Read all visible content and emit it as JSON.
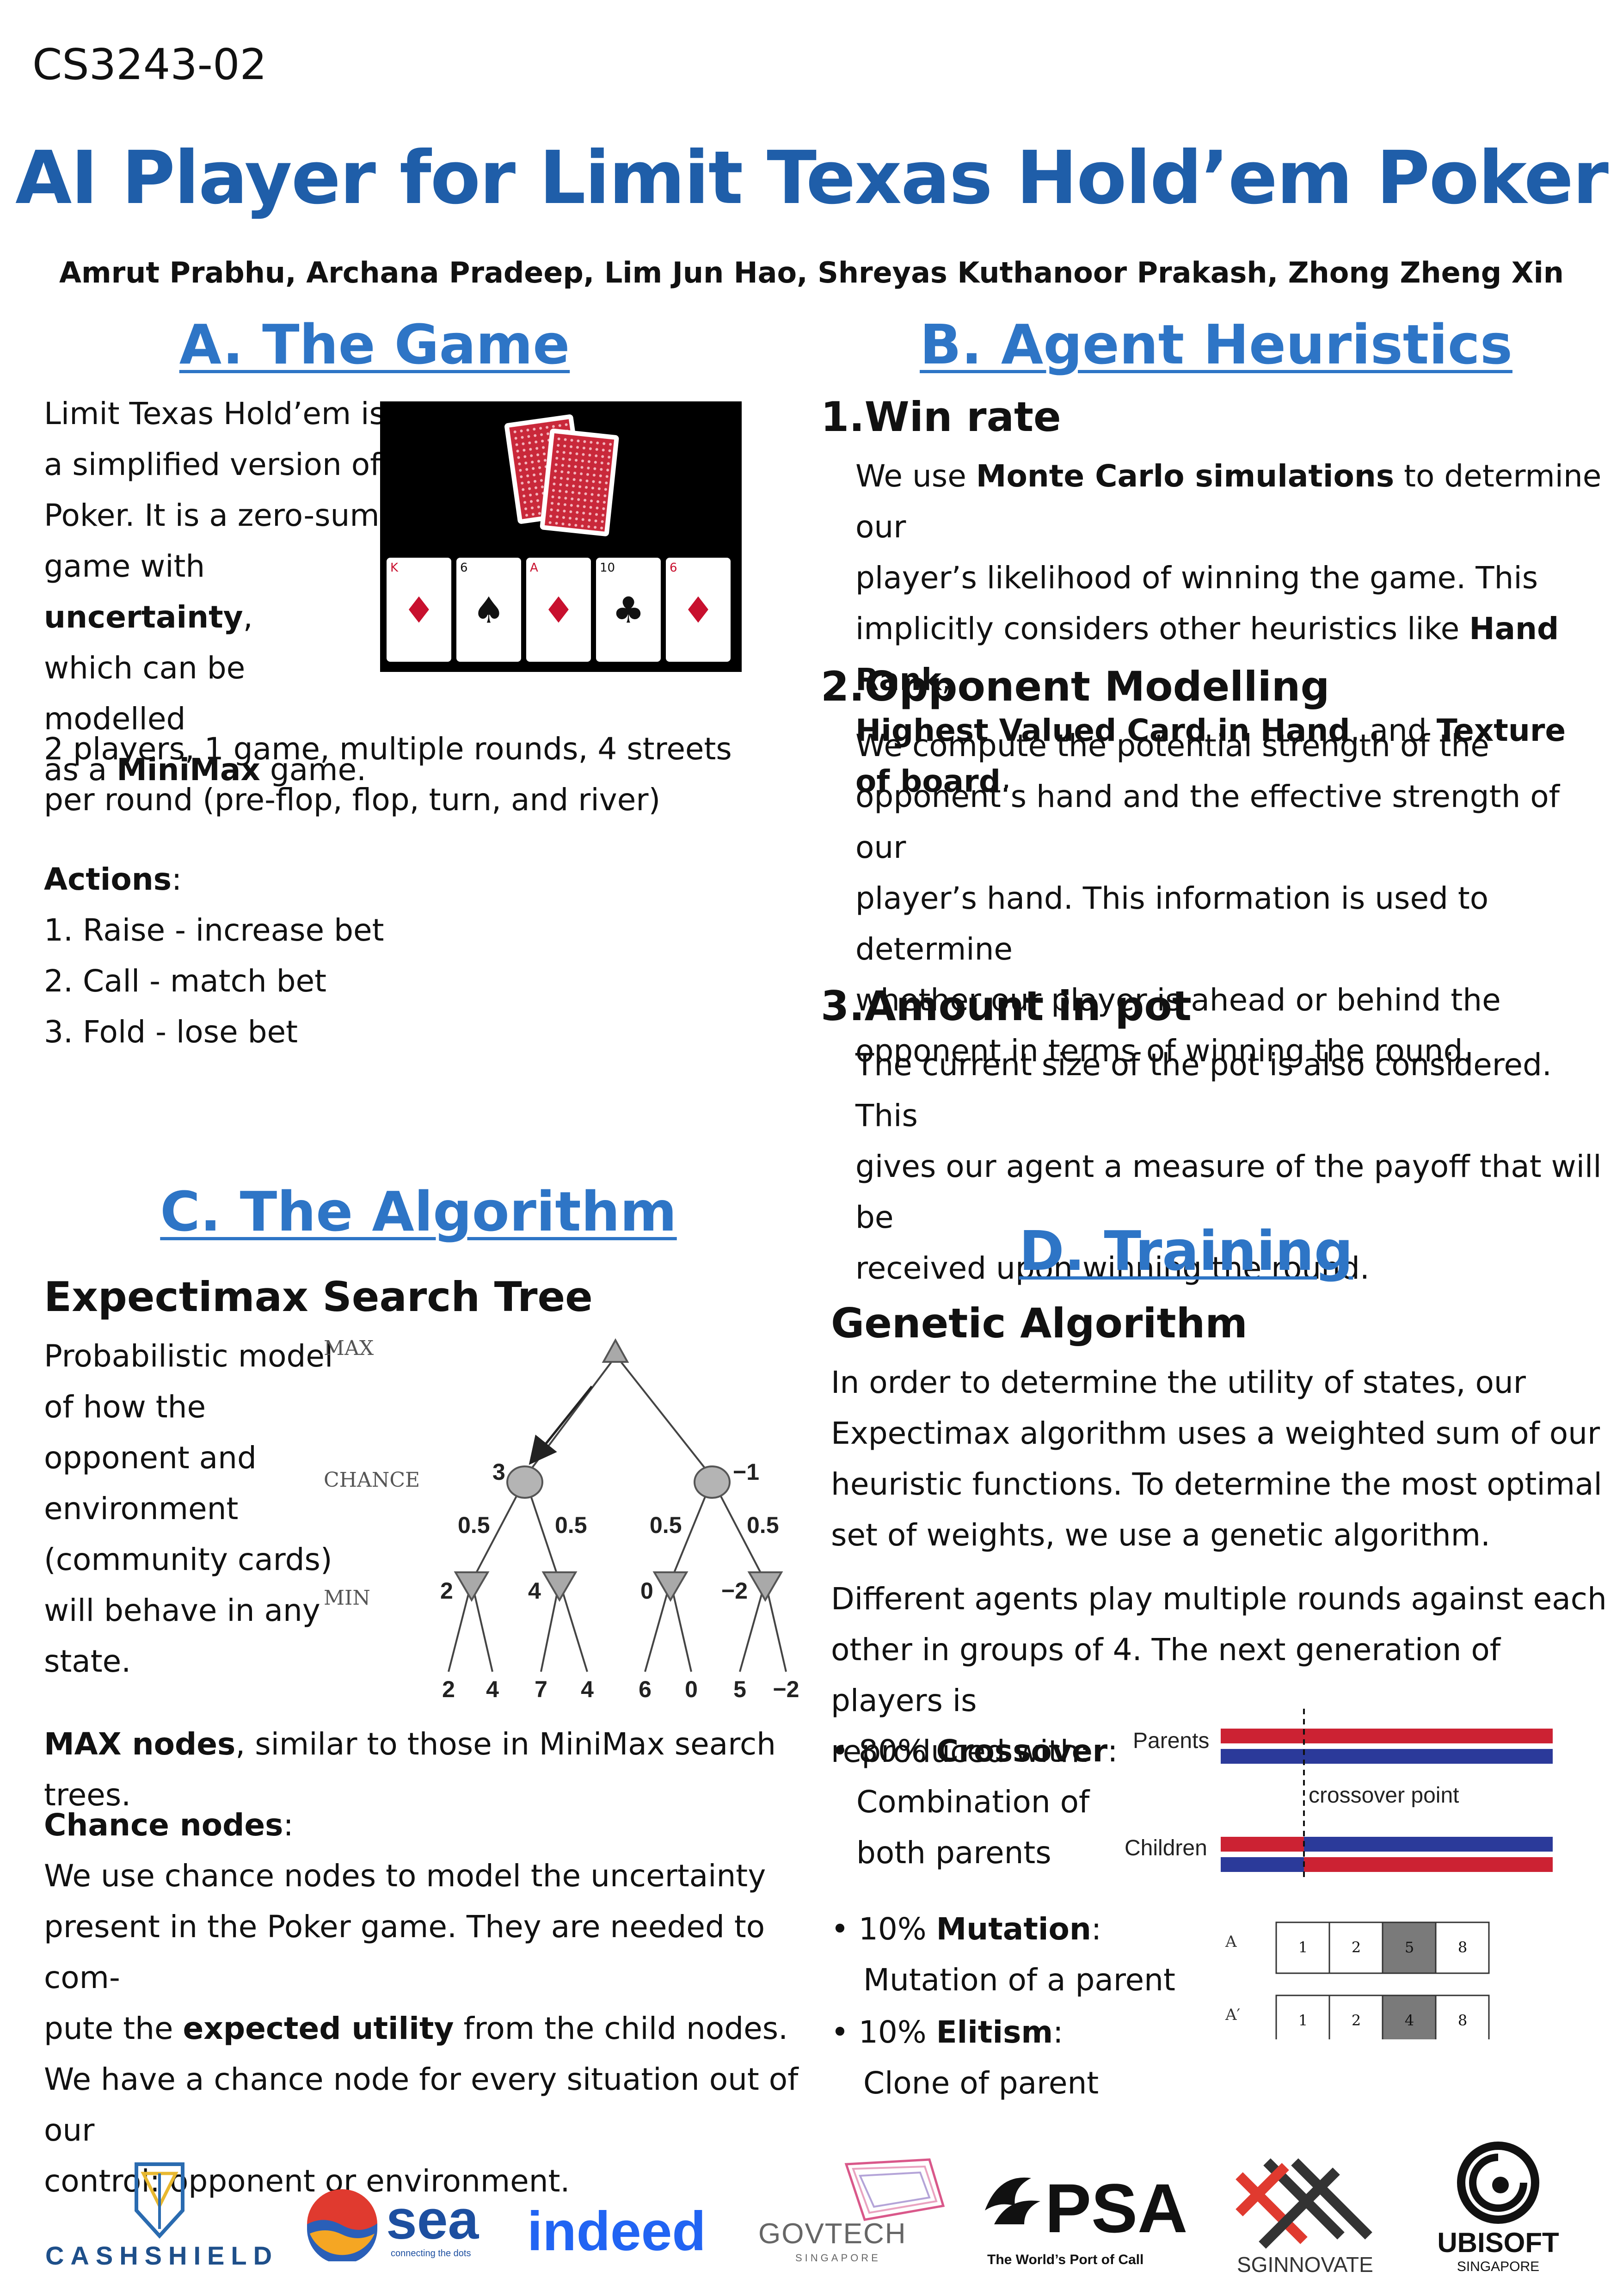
{
  "header": {
    "course_code": "CS3243-02",
    "title": "AI Player for Limit Texas Hold’em Poker",
    "authors": "Amrut Prabhu, Archana Pradeep, Lim Jun Hao, Shreyas Kuthanoor Prakash, Zhong Zheng Xin"
  },
  "section_a": {
    "heading": "A. The Game",
    "intro_lines": [
      "Limit Texas Hold’em is",
      "a simplified version of",
      "Poker. It is a zero-sum"
    ],
    "intro_line4_pre": "game with ",
    "intro_line4_bold": "uncertainty",
    "intro_line4_post": ",",
    "intro_line5": "which can be modelled",
    "intro_line6_pre": "as a ",
    "intro_line6_bold": "MiniMax",
    "intro_line6_post": " game.",
    "players_line1": "2 players, 1 game, multiple rounds, 4 streets",
    "players_line2": "per round (pre-flop, flop, turn, and river)",
    "actions_label": "Actions",
    "actions_colon": ":",
    "actions": [
      "1. Raise - increase bet",
      "2. Call - match bet",
      "3. Fold - lose bet"
    ],
    "cards": [
      {
        "rank": "K",
        "suit": "♦",
        "color": "#c8102e"
      },
      {
        "rank": "6",
        "suit": "♠",
        "color": "#111111"
      },
      {
        "rank": "A",
        "suit": "♦",
        "color": "#c8102e"
      },
      {
        "rank": "10",
        "suit": "♣",
        "color": "#111111"
      },
      {
        "rank": "6",
        "suit": "♦",
        "color": "#c8102e"
      }
    ]
  },
  "section_b": {
    "heading": "B. Agent Heuristics",
    "item1_heading": "1.Win rate",
    "item1_l1_pre": "We use ",
    "item1_l1_bold": "Monte Carlo simulations",
    "item1_l1_post": " to determine our",
    "item1_l2": "player’s likelihood of winning the game. This",
    "item1_l3_pre": "implicitly considers other heuristics like ",
    "item1_l3_bold": "Hand Rank",
    "item1_l3_post": ",",
    "item1_l4_bold1": "Highest Valued Card in Hand",
    "item1_l4_mid": ", and ",
    "item1_l4_bold2": "Texture of board",
    "item1_l4_post": ".",
    "item2_heading": "2.Opponent Modelling",
    "item2_lines": [
      "We compute the potential strength of the",
      "opponent’s hand and the effective strength of our",
      "player’s hand. This information is used to determine",
      "whether our player is ahead or behind the",
      "opponent in terms of winning the round."
    ],
    "item3_heading": "3.Amount in pot",
    "item3_lines": [
      "The current size of the pot is also considered. This",
      "gives our agent a measure of the payoff that will be",
      "received upon winning the round."
    ]
  },
  "section_c": {
    "heading": "C. The Algorithm",
    "subheading": "Expectimax Search Tree",
    "desc_lines": [
      "Probabilistic model",
      "of how the",
      "opponent and",
      "environment",
      "(community cards)",
      "will behave in any",
      "state."
    ],
    "tree": {
      "level_labels": [
        "MAX",
        "CHANCE",
        "MIN"
      ],
      "chance_values": [
        "3",
        "−1"
      ],
      "probabilities": [
        "0.5",
        "0.5",
        "0.5",
        "0.5"
      ],
      "min_values": [
        "2",
        "4",
        "0",
        "−2"
      ],
      "leaf_values": [
        "2",
        "4",
        "7",
        "4",
        "6",
        "0",
        "5",
        "−2"
      ]
    },
    "max_nodes_bold": "MAX nodes",
    "max_nodes_text": ", similar to those in MiniMax search trees.",
    "chance_label": "Chance nodes",
    "chance_colon": ":",
    "chance_l1": "We use chance nodes to model the uncertainty",
    "chance_l2": "present in the Poker game. They are needed to com-",
    "chance_l3_pre": "pute the ",
    "chance_l3_bold": "expected utility",
    "chance_l3_post": " from the child nodes.",
    "chance_l4": "We have a chance node for every situation out of our",
    "chance_l5": "control: opponent or environment."
  },
  "section_d": {
    "heading": "D. Training",
    "subheading": "Genetic Algorithm",
    "p1_lines": [
      "In order to determine the utility of states, our",
      "Expectimax algorithm uses a weighted sum of our",
      "heuristic functions. To determine the most optimal",
      "set of weights, we use a genetic algorithm."
    ],
    "p2_lines": [
      "Different agents play multiple rounds against each",
      "other in groups of 4. The next generation of players is",
      "reproduced with:"
    ],
    "crossover_pct": "• 80% ",
    "crossover_bold": "Crossover",
    "crossover_colon": ":",
    "crossover_desc1": "Combination of",
    "crossover_desc2": "both parents",
    "mutation_pct": "• 10% ",
    "mutation_bold": "Mutation",
    "mutation_colon": ":",
    "mutation_desc": "Mutation of a parent",
    "elitism_pct": "• 10% ",
    "elitism_bold": "Elitism",
    "elitism_colon": ":",
    "elitism_desc": "Clone of parent",
    "crossover_diagram": {
      "parents_label": "Parents",
      "children_label": "Children",
      "point_label": "crossover point",
      "red": "#cc2233",
      "blue": "#2b3a9a"
    },
    "mutation_diagram": {
      "row_a_label": "A",
      "row_a_prime_label": "A′",
      "row_a": [
        "1",
        "2",
        "5",
        "8"
      ],
      "row_a_prime": [
        "1",
        "2",
        "4",
        "8"
      ]
    }
  },
  "sponsors": {
    "cashshield": "CASHSHIELD",
    "sea": "sea",
    "sea_tagline": "connecting the dots",
    "indeed": "indeed",
    "govtech": "GOVTECH",
    "govtech_sub": "SINGAPORE",
    "psa": "PSA",
    "psa_tagline": "The World’s Port of Call",
    "sginnovate": "SGINNOVATE",
    "ubisoft": "UBISOFT",
    "ubisoft_sub": "SINGAPORE"
  }
}
